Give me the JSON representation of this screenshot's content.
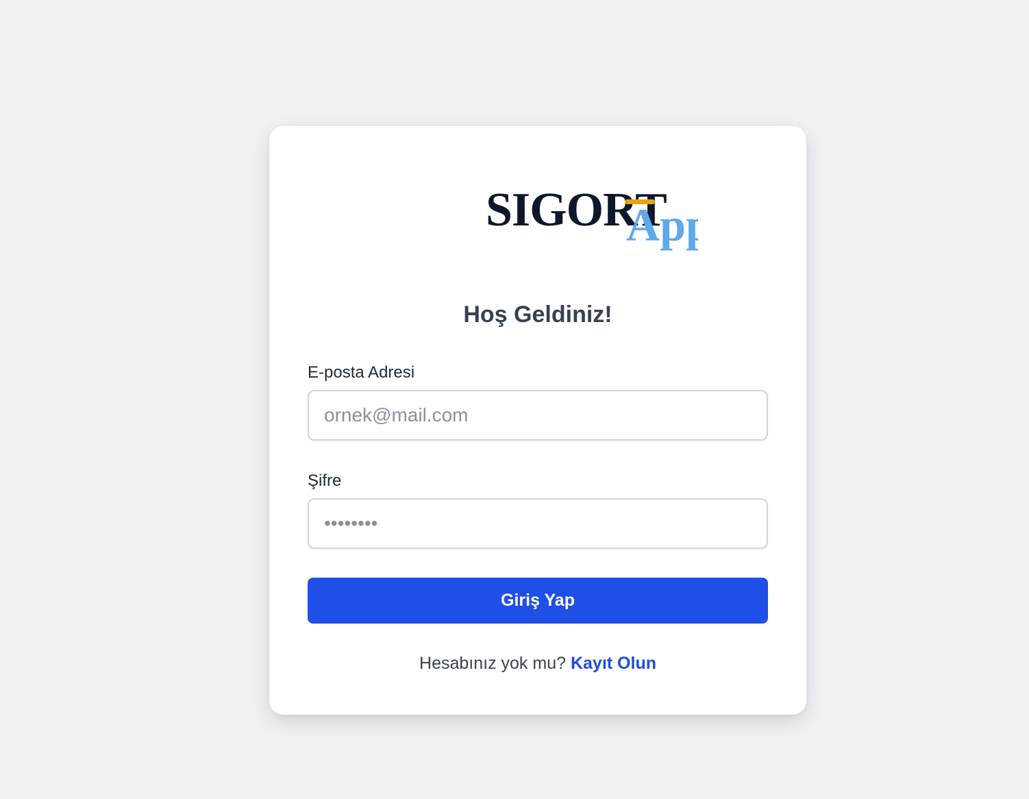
{
  "logo": {
    "main_text": "SIGORT",
    "accent_text": "App",
    "colors": {
      "main": "#0f172a",
      "accent": "#5ea8ec",
      "mark": "#e6a614"
    }
  },
  "welcome_title": "Hoş Geldiniz!",
  "email": {
    "label": "E-posta Adresi",
    "placeholder": "ornek@mail.com",
    "value": ""
  },
  "password": {
    "label": "Şifre",
    "placeholder": "••••••••",
    "value": ""
  },
  "login_button": {
    "label": "Giriş Yap",
    "color": "#1e4fe6"
  },
  "register": {
    "prompt": "Hesabınız yok mu?",
    "link_label": "Kayıt Olun"
  }
}
